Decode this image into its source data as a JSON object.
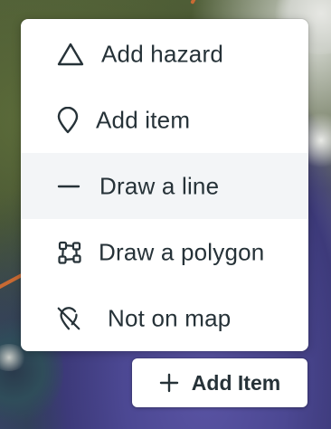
{
  "colors": {
    "menu_background": "#ffffff",
    "active_item_background": "#f3f5f7",
    "text": "#263238",
    "road": "#c96a33",
    "water": "#4c4893"
  },
  "menu": {
    "items": [
      {
        "label": "Add hazard",
        "icon": "triangle-icon",
        "active": false
      },
      {
        "label": "Add item",
        "icon": "map-pin-icon",
        "active": false
      },
      {
        "label": "Draw a line",
        "icon": "line-icon",
        "active": true
      },
      {
        "label": "Draw a polygon",
        "icon": "polygon-icon",
        "active": false
      },
      {
        "label": "Not on map",
        "icon": "map-pin-off-icon",
        "active": false
      }
    ]
  },
  "add_button": {
    "label": "Add Item",
    "icon": "plus-icon"
  }
}
